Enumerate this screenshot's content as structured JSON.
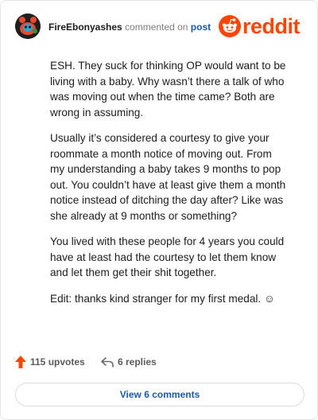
{
  "header": {
    "username": "FireEbonyashes",
    "action_text": "commented on",
    "post_link": "post",
    "brand": "reddit"
  },
  "comment": {
    "paragraphs": [
      "ESH. They suck for thinking OP would want to be living with a baby. Why wasn’t there a talk of who was moving out when the time came? Both are wrong in assuming.",
      "Usually it’s considered a courtesy to give your roommate a month notice of moving out. From my understanding a baby takes 9 months to pop out. You couldn’t have at least give them a month notice instead of ditching the day after? Like was she already at 9 months or something?",
      "You lived with these people for 4 years you could have at least had the courtesy to let them know and let them get their shit together.",
      "Edit: thanks kind stranger for my first medal. ☺"
    ]
  },
  "footer": {
    "upvotes": "115 upvotes",
    "replies": "6 replies"
  },
  "view_button": "View 6 comments",
  "colors": {
    "brand": "#ff4500",
    "link": "#1a5aa6",
    "upvote": "#ff4500",
    "muted": "#7c7c7c"
  },
  "icons": {
    "avatar": "snoo-avatar",
    "brand_mark": "reddit-alien-icon",
    "upvote": "upvote-arrow-icon",
    "reply": "reply-arrow-icon"
  }
}
